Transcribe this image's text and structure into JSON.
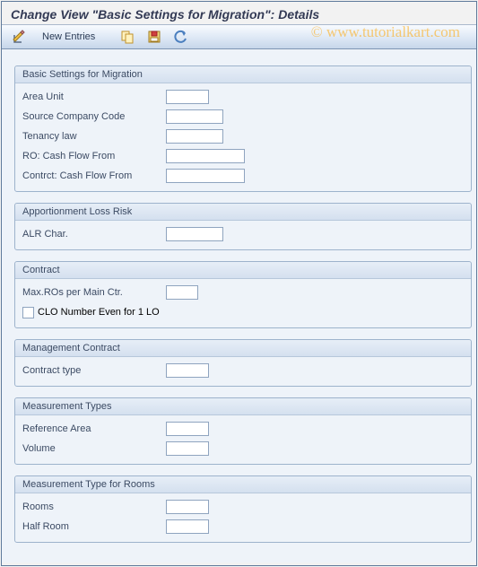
{
  "header": {
    "title": "Change View \"Basic Settings for Migration\": Details"
  },
  "watermark": "© www.tutorialkart.com",
  "toolbar": {
    "new_entries": "New Entries"
  },
  "groups": {
    "basic": {
      "title": "Basic Settings for Migration",
      "area_unit": "Area Unit",
      "source_company": "Source Company Code",
      "tenancy_law": "Tenancy law",
      "ro_cash_flow": "RO: Cash Flow From",
      "contract_cash_flow": "Contrct: Cash Flow From"
    },
    "alr": {
      "title": "Apportionment Loss Risk",
      "alr_char": "ALR Char."
    },
    "contract": {
      "title": "Contract",
      "max_ros": "Max.ROs per Main Ctr.",
      "clo_checkbox": "CLO Number Even for 1 LO"
    },
    "mgmt": {
      "title": "Management Contract",
      "contract_type": "Contract type"
    },
    "meas": {
      "title": "Measurement Types",
      "ref_area": "Reference Area",
      "volume": "Volume"
    },
    "rooms": {
      "title": "Measurement Type for Rooms",
      "rooms": "Rooms",
      "half_room": "Half Room"
    }
  },
  "values": {
    "area_unit": "",
    "source_company": "",
    "tenancy_law": "",
    "ro_cash_flow": "",
    "contract_cash_flow": "",
    "alr_char": "",
    "max_ros": "",
    "contract_type": "",
    "ref_area": "",
    "volume": "",
    "rooms": "",
    "half_room": ""
  }
}
